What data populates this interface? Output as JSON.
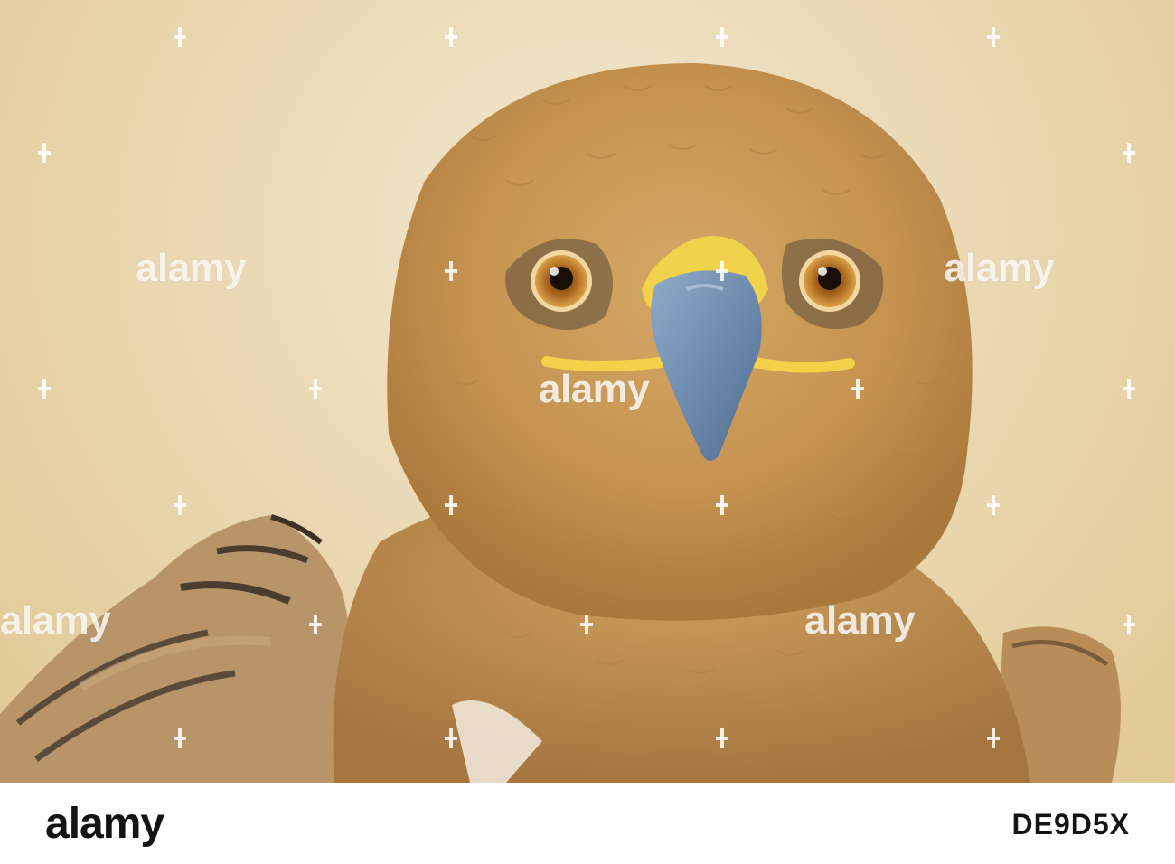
{
  "watermark": {
    "text": "alamy"
  },
  "footer": {
    "logo": "alamy",
    "image_id": "DE9D5X"
  },
  "colors": {
    "background": "#ead9b4",
    "plumage": "#c99a55",
    "beak": "#6f8fb5",
    "cere": "#f0d34a",
    "iris": "#a8641c"
  }
}
